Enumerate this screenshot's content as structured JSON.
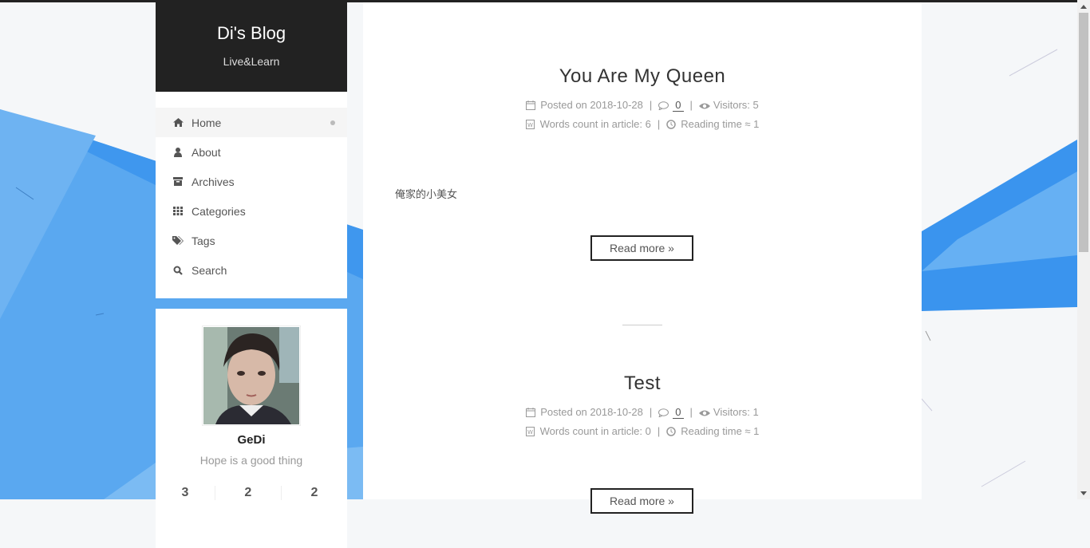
{
  "site": {
    "title": "Di's Blog",
    "subtitle": "Live&Learn"
  },
  "menu": [
    {
      "label": "Home",
      "icon": "home-icon",
      "active": true
    },
    {
      "label": "About",
      "icon": "user-icon",
      "active": false
    },
    {
      "label": "Archives",
      "icon": "archive-icon",
      "active": false
    },
    {
      "label": "Categories",
      "icon": "grid-icon",
      "active": false
    },
    {
      "label": "Tags",
      "icon": "tags-icon",
      "active": false
    },
    {
      "label": "Search",
      "icon": "search-icon",
      "active": false
    }
  ],
  "profile": {
    "name": "GeDi",
    "description": "Hope is a good thing",
    "stats": [
      "3",
      "2",
      "2"
    ]
  },
  "posts": [
    {
      "title": "You Are My Queen",
      "posted_on": "Posted on 2018-10-28",
      "comments": "0",
      "visitors": "Visitors: 5",
      "words": "Words count in article: 6",
      "reading": "Reading time ≈ 1",
      "excerpt": "俺家的小美女",
      "button": "Read more »"
    },
    {
      "title": "Test",
      "posted_on": "Posted on 2018-10-28",
      "comments": "0",
      "visitors": "Visitors: 1",
      "words": "Words count in article: 0",
      "reading": "Reading time ≈ 1",
      "button": "Read more »"
    }
  ],
  "colors": {
    "header_bg": "#222222",
    "background_blue": "#4a9ff0",
    "accent_blue": "#2e8be8"
  }
}
